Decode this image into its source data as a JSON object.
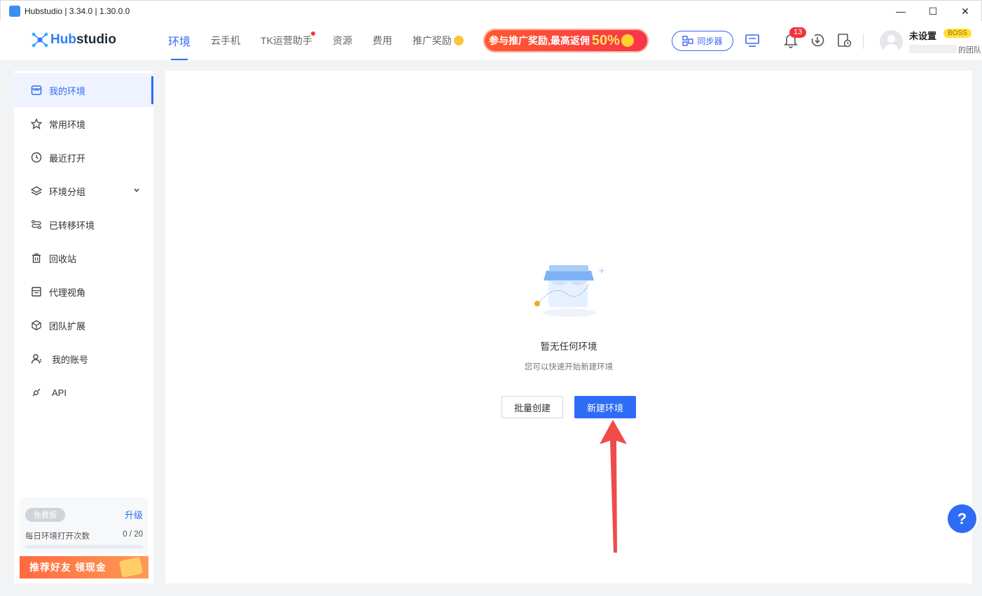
{
  "window": {
    "title": "Hubstudio | 3.34.0 | 1.30.0.0",
    "controls": [
      "—",
      "☐",
      "✕"
    ]
  },
  "header": {
    "logo_text_hub": "Hub",
    "logo_text_studio": "studio",
    "nav": [
      {
        "label": "环境",
        "active": true
      },
      {
        "label": "云手机"
      },
      {
        "label": "TK运营助手",
        "dot": true
      },
      {
        "label": "资源"
      },
      {
        "label": "费用"
      },
      {
        "label": "推广奖励"
      }
    ],
    "promo": {
      "text": "参与推广奖励,最高返佣",
      "highlight": "50%"
    },
    "sync_label": "同步器",
    "notification_count": "13",
    "user": {
      "name": "未设置",
      "tag": "BOSS",
      "team": "的团队"
    }
  },
  "sidebar": {
    "items": [
      {
        "label": "我的环境",
        "icon": "store-icon",
        "active": true
      },
      {
        "label": "常用环境",
        "icon": "star-icon"
      },
      {
        "label": "最近打开",
        "icon": "clock-icon"
      },
      {
        "label": "环境分组",
        "icon": "layers-icon",
        "expandable": true
      },
      {
        "label": "已转移环境",
        "icon": "transfer-icon"
      },
      {
        "label": "回收站",
        "icon": "trash-icon"
      },
      {
        "label": "代理视角",
        "icon": "proxy-icon"
      },
      {
        "label": "团队扩展",
        "icon": "cube-icon"
      },
      {
        "label": "我的账号",
        "icon": "user-icon"
      },
      {
        "label": "API",
        "icon": "api-icon"
      }
    ],
    "plan": {
      "tag": "免费版",
      "upgrade": "升级",
      "quota_label": "每日环境打开次数",
      "quota_value": "0 / 20",
      "quota_fraction": 0
    },
    "referral": "推荐好友 领现金"
  },
  "main": {
    "empty_title": "暂无任何环境",
    "empty_subtitle": "您可以快速开始新建环境",
    "batch_create": "批量创建",
    "new_env": "新建环境"
  },
  "help": "?",
  "colors": {
    "accent": "#2e6cf6",
    "annotation_arrow": "#f04a4a"
  }
}
